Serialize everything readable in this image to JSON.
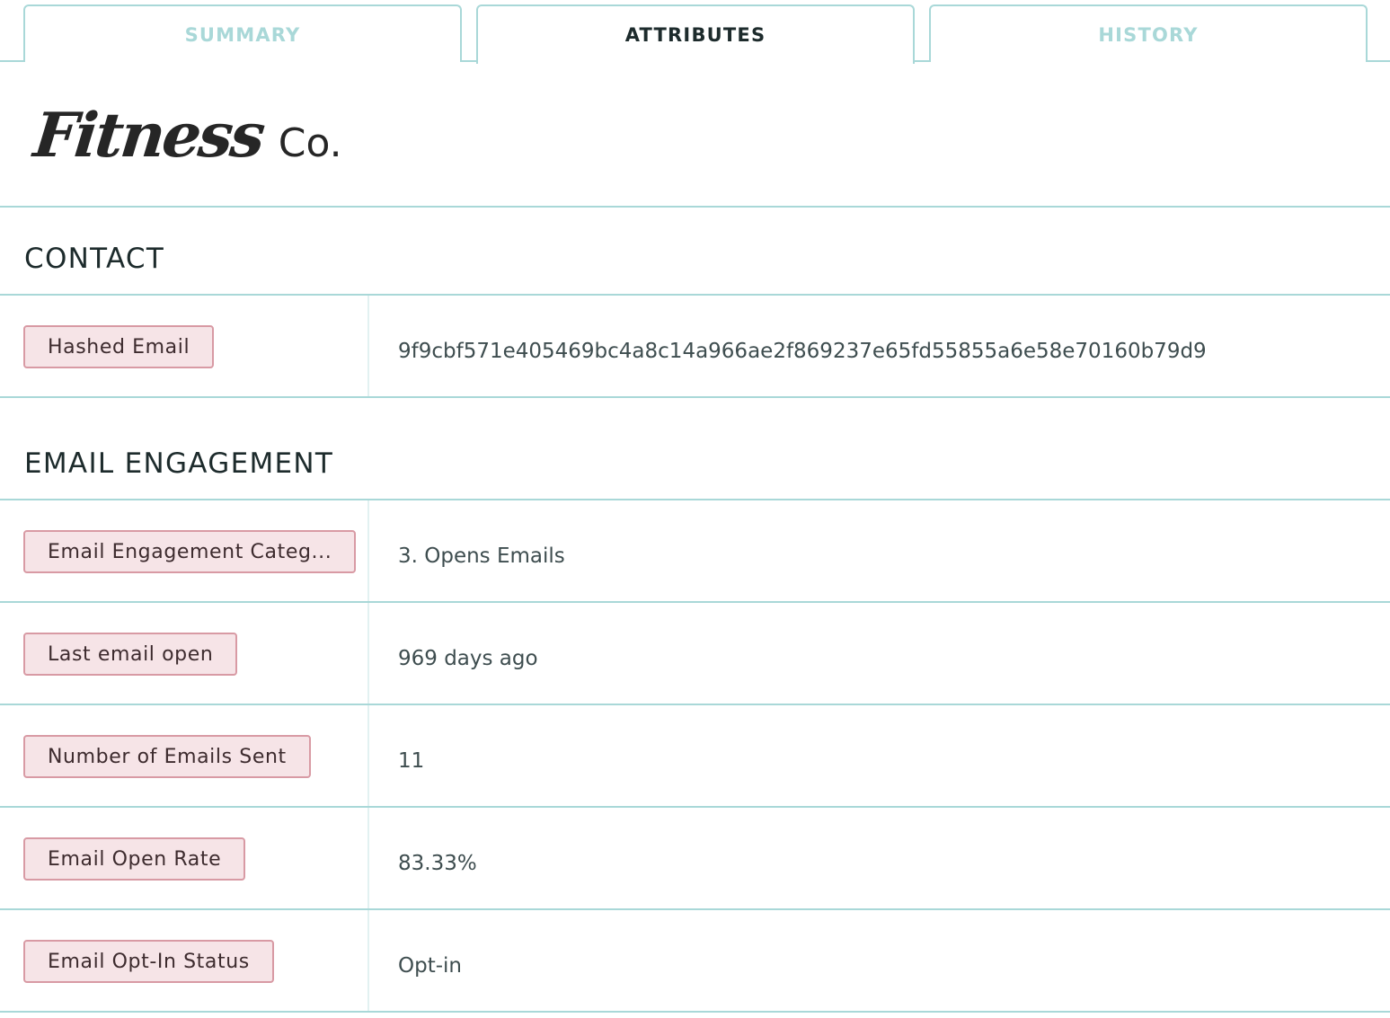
{
  "tabs": [
    {
      "label": "SUMMARY",
      "active": false
    },
    {
      "label": "ATTRIBUTES",
      "active": true
    },
    {
      "label": "HISTORY",
      "active": false
    }
  ],
  "logo": {
    "script": "Fitness",
    "suffix": "Co."
  },
  "sections": {
    "contact": {
      "title": "CONTACT",
      "rows": [
        {
          "label": "Hashed Email",
          "value": "9f9cbf571e405469bc4a8c14a966ae2f869237e65fd55855a6e58e70160b79d9"
        }
      ]
    },
    "email_engagement": {
      "title": "EMAIL ENGAGEMENT",
      "rows": [
        {
          "label": "Email Engagement Categ...",
          "value": "3. Opens Emails"
        },
        {
          "label": "Last email open",
          "value": "969 days ago"
        },
        {
          "label": "Number of Emails Sent",
          "value": "11"
        },
        {
          "label": "Email Open Rate",
          "value": "83.33%"
        },
        {
          "label": "Email Opt-In Status",
          "value": "Opt-in"
        }
      ]
    }
  },
  "colors": {
    "divider": "#a9d8d8",
    "pill_bg": "#f6e4e7",
    "pill_border": "#d89aa4",
    "text_dark": "#1d2b2c",
    "tab_inactive": "#a9d8d8"
  }
}
